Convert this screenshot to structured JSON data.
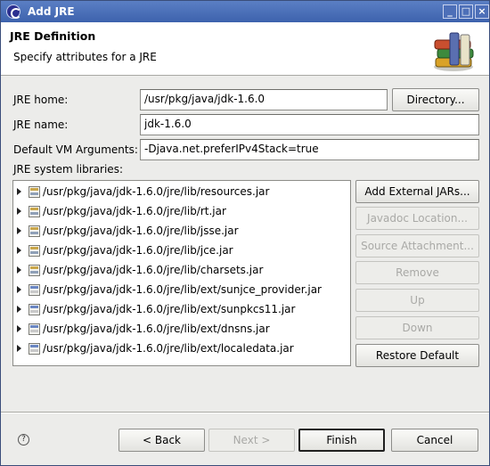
{
  "window": {
    "title": "Add JRE",
    "minimize_glyph": "_",
    "maximize_glyph": "□",
    "close_glyph": "×"
  },
  "banner": {
    "title": "JRE Definition",
    "description": "Specify attributes for a JRE"
  },
  "form": {
    "jre_home_label": "JRE home:",
    "jre_home_value": "/usr/pkg/java/jdk-1.6.0",
    "directory_button": "Directory...",
    "jre_name_label": "JRE name:",
    "jre_name_value": "jdk-1.6.0",
    "vm_args_label": "Default VM Arguments:",
    "vm_args_value": "-Djava.net.preferIPv4Stack=true",
    "libraries_label": "JRE system libraries:"
  },
  "libraries": [
    {
      "path": "/usr/pkg/java/jdk-1.6.0/jre/lib/resources.jar",
      "icon": "jar-icon"
    },
    {
      "path": "/usr/pkg/java/jdk-1.6.0/jre/lib/rt.jar",
      "icon": "jar-icon"
    },
    {
      "path": "/usr/pkg/java/jdk-1.6.0/jre/lib/jsse.jar",
      "icon": "jar-icon"
    },
    {
      "path": "/usr/pkg/java/jdk-1.6.0/jre/lib/jce.jar",
      "icon": "jar-icon"
    },
    {
      "path": "/usr/pkg/java/jdk-1.6.0/jre/lib/charsets.jar",
      "icon": "jar-icon"
    },
    {
      "path": "/usr/pkg/java/jdk-1.6.0/jre/lib/ext/sunjce_provider.jar",
      "icon": "ext-jar-icon"
    },
    {
      "path": "/usr/pkg/java/jdk-1.6.0/jre/lib/ext/sunpkcs11.jar",
      "icon": "ext-jar-icon"
    },
    {
      "path": "/usr/pkg/java/jdk-1.6.0/jre/lib/ext/dnsns.jar",
      "icon": "ext-jar-icon"
    },
    {
      "path": "/usr/pkg/java/jdk-1.6.0/jre/lib/ext/localedata.jar",
      "icon": "ext-jar-icon"
    }
  ],
  "side_buttons": {
    "add_external_jars": "Add External JARs...",
    "javadoc_location": "Javadoc Location...",
    "source_attachment": "Source Attachment...",
    "remove": "Remove",
    "up": "Up",
    "down": "Down",
    "restore_default": "Restore Default"
  },
  "footer": {
    "help_glyph": "?",
    "back": "< Back",
    "next": "Next >",
    "finish": "Finish",
    "cancel": "Cancel"
  },
  "colors": {
    "title_bar": "#3d62ad",
    "dialog_bg": "#ececea",
    "disabled_text": "#a9a9a6"
  }
}
